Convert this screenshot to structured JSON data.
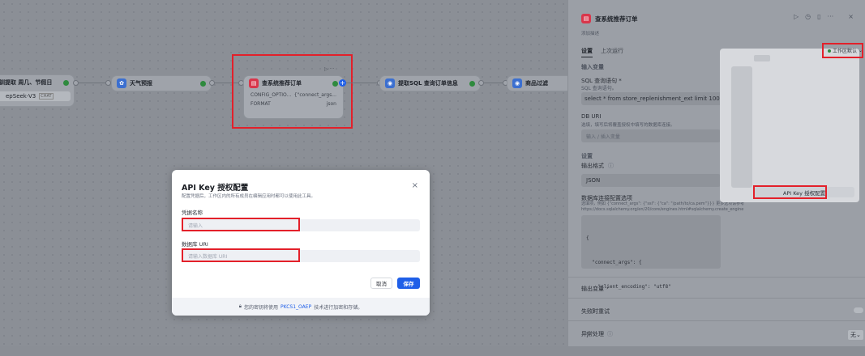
{
  "canvas": {
    "node_partial_left": {
      "title": "钏提取 周几、节假日",
      "model_tag": "epSeek-V3",
      "model_badge": "CHAT"
    },
    "node_weather": {
      "title": "天气预报"
    },
    "node_query": {
      "title": "查系统推荐订单",
      "more": "▷ ···",
      "rows": [
        {
          "key": "CONFIG_OPTIO...",
          "value": "{\"connect_args..."
        },
        {
          "key": "FORMAT",
          "value": "json"
        }
      ]
    },
    "node_extract": {
      "title": "提取SQL 查询订单信息"
    },
    "node_filter": {
      "title": "商品过滤"
    }
  },
  "panel": {
    "title": "查系统推荐订单",
    "subtitle": "添加描述",
    "header_icons": [
      "play-icon",
      "clock-icon",
      "book-icon",
      "more-icon",
      "close-icon"
    ],
    "tabs": [
      "设置",
      "上次运行"
    ],
    "env_label": "工作区默认",
    "input_vars_label": "输入变量",
    "sql_label": "SQL 查询语句 *",
    "sql_desc": "SQL 查询语句。",
    "sql_value": "select * from store_replenishment_ext limit 100;",
    "db_uri_label": "DB URI",
    "db_uri_desc": "选填，填写后将覆盖授权中填写的数据库连接。",
    "db_uri_placeholder": "输入 / 插入变量",
    "settings_label": "设置",
    "output_format_label": "输出格式",
    "output_format_value": "JSON",
    "db_options_label": "数据库连接配置选项",
    "db_options_desc": "选填项，例如 {\"connect_args\": {\"ssl\": {\"ca\": \"/path/to/ca.pem\"}}} 更多选项请参考",
    "db_options_link": "https://docs.sqlalchemy.org/en/20/core/engines.html#sqlalchemy.create_engine",
    "code_lines": [
      "{",
      "  \"connect_args\": {",
      "    \"client_encoding\": \"utf8\"",
      "  }",
      "}"
    ],
    "output_vars_label": "输出变量",
    "retry_label": "失败时重试",
    "error_label": "异常处理",
    "error_value": "无",
    "dropdown_button": "API Key 授权配置"
  },
  "modal": {
    "title": "API Key 授权配置",
    "desc": "配置凭据后，工作区内的所有成员在编辑应用时都可以使用此工具。",
    "cred_label": "凭据名称",
    "cred_placeholder": "请输入",
    "uri_label": "数据库 URI",
    "uri_placeholder": "请输入数据库 URI",
    "cancel": "取消",
    "save": "保存",
    "footer_prefix": "您的密钥将使用",
    "footer_link": "PKCS1_OAEP",
    "footer_suffix": "技术进行加密和存储。"
  },
  "colors": {
    "accent": "#1f5fe8",
    "highlight": "#e3202a",
    "success": "#2f8a3e"
  }
}
